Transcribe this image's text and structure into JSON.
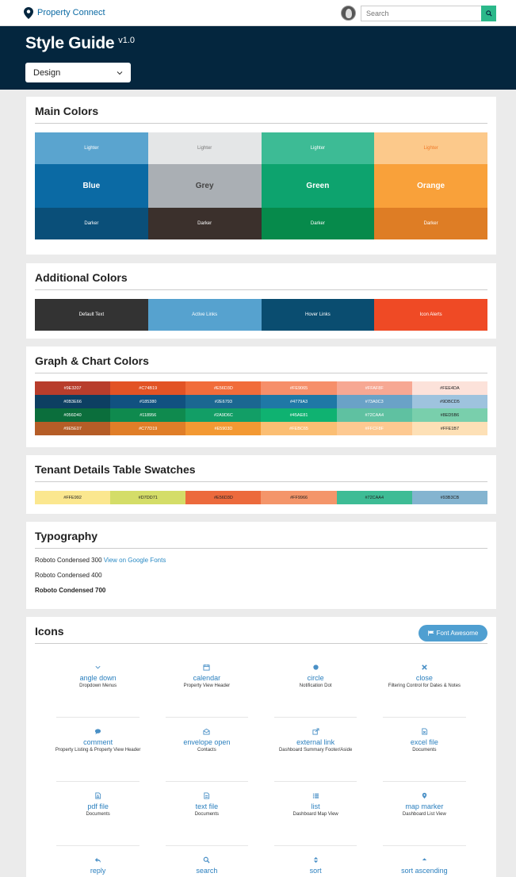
{
  "topbar": {
    "brand": "Property Connect",
    "search_placeholder": "Search"
  },
  "header": {
    "title": "Style Guide",
    "version": "v1.0",
    "select_value": "Design"
  },
  "main_colors": {
    "heading": "Main Colors",
    "columns": [
      {
        "lighter": "Lighter",
        "main": "Blue",
        "darker": "Darker",
        "colors": [
          "#5aa4cf",
          "#0b6aa4",
          "#0a4f79"
        ],
        "lighter_text": "#ffffff"
      },
      {
        "lighter": "Lighter",
        "main": "Grey",
        "darker": "Darker",
        "colors": [
          "#e4e6e7",
          "#aaafb4",
          "#3b302c"
        ],
        "lighter_text": "#777777"
      },
      {
        "lighter": "Lighter",
        "main": "Green",
        "darker": "Darker",
        "colors": [
          "#3dbb95",
          "#0da36e",
          "#068a4b"
        ],
        "lighter_text": "#ffffff"
      },
      {
        "lighter": "Lighter",
        "main": "Orange",
        "darker": "Darker",
        "colors": [
          "#fcc98b",
          "#f9a13a",
          "#de7d25"
        ],
        "lighter_text": "#f07a2a"
      }
    ]
  },
  "additional_colors": {
    "heading": "Additional Colors",
    "items": [
      {
        "label": "Default Text",
        "color": "#333333"
      },
      {
        "label": "Active Links",
        "color": "#56a2cf"
      },
      {
        "label": "Hover Links",
        "color": "#0a4d70"
      },
      {
        "label": "Icon Alerts",
        "color": "#ef4a25"
      }
    ]
  },
  "graph_colors": {
    "heading": "Graph & Chart Colors",
    "rows": [
      [
        "#9E3207",
        "#C74B19",
        "#E56D3D",
        "#FE9065",
        "#FFAF8F",
        "#FEE4DA"
      ],
      [
        "#0B3E66",
        "#185380",
        "#2E6793",
        "#4779A3",
        "#73A0C3",
        "#9DBCD5"
      ],
      [
        "#056D40",
        "#118956",
        "#2A9D6C",
        "#45AE81",
        "#72CAA4",
        "#8ED5B6"
      ],
      [
        "#9E5E07",
        "#C77D19",
        "#E5903D",
        "#FEBC65",
        "#FFCF8F",
        "#FFE1B7"
      ]
    ],
    "swatches": [
      [
        "#b83d2c",
        "#e25325",
        "#f16c3a",
        "#f68f6a",
        "#f7a893",
        "#fce2da"
      ],
      [
        "#0d3f62",
        "#115180",
        "#1b6791",
        "#1f78a6",
        "#6aa2c7",
        "#9ec3de"
      ],
      [
        "#0b6e3c",
        "#0f8a4e",
        "#129e66",
        "#0fb271",
        "#5fc1a1",
        "#79cfac"
      ],
      [
        "#b55d27",
        "#e07e28",
        "#f39933",
        "#fbbe73",
        "#fdc991",
        "#fde0b6"
      ]
    ],
    "text_colors": [
      "#ffffff",
      "#ffffff",
      "#ffffff",
      "#ffffff",
      "#ffffff",
      "#222222"
    ]
  },
  "tenant_swatches": {
    "heading": "Tenant Details Table Swatches",
    "items": [
      {
        "label": "#FFE992",
        "color": "#fbe78f"
      },
      {
        "label": "#D7DD71",
        "color": "#d4dd68"
      },
      {
        "label": "#E56D3D",
        "color": "#ec6a3c"
      },
      {
        "label": "#FF9966",
        "color": "#f4956a"
      },
      {
        "label": "#72CAA4",
        "color": "#3ebc95"
      },
      {
        "label": "#93B3CB",
        "color": "#84b4d0"
      }
    ]
  },
  "typography": {
    "heading": "Typography",
    "line1": "Roboto Condensed 300",
    "link": "View on Google Fonts",
    "line2": "Roboto Condensed 400",
    "line3": "Roboto Condensed 700"
  },
  "icons": {
    "heading": "Icons",
    "badge": "Font Awesome",
    "items": [
      {
        "name": "angle down",
        "desc": "Dropdown Menus",
        "icon": "angle-down-icon"
      },
      {
        "name": "calendar",
        "desc": "Property View Header",
        "icon": "calendar-icon"
      },
      {
        "name": "circle",
        "desc": "Notification Dot",
        "icon": "circle-icon"
      },
      {
        "name": "close",
        "desc": "Filtering Control for Dates & Notes",
        "icon": "close-icon"
      },
      {
        "name": "comment",
        "desc": "Property Listing & Property View Header",
        "icon": "comment-icon"
      },
      {
        "name": "envelope open",
        "desc": "Contacts",
        "icon": "envelope-open-icon"
      },
      {
        "name": "external link",
        "desc": "Dashboard Summary Footer/Aside",
        "icon": "external-link-icon"
      },
      {
        "name": "excel file",
        "desc": "Documents",
        "icon": "excel-file-icon"
      },
      {
        "name": "pdf file",
        "desc": "Documents",
        "icon": "pdf-file-icon"
      },
      {
        "name": "text file",
        "desc": "Documents",
        "icon": "text-file-icon"
      },
      {
        "name": "list",
        "desc": "Dashboard Map View",
        "icon": "list-icon"
      },
      {
        "name": "map marker",
        "desc": "Dashboard List View",
        "icon": "map-marker-icon"
      },
      {
        "name": "reply",
        "desc": "",
        "icon": "reply-icon"
      },
      {
        "name": "search",
        "desc": "",
        "icon": "search-icon"
      },
      {
        "name": "sort",
        "desc": "",
        "icon": "sort-icon"
      },
      {
        "name": "sort ascending",
        "desc": "",
        "icon": "sort-ascending-icon"
      }
    ]
  },
  "colors": {
    "header_bg": "#04263e",
    "accent_green": "#2bb88a",
    "link_blue": "#2a7fbe"
  }
}
